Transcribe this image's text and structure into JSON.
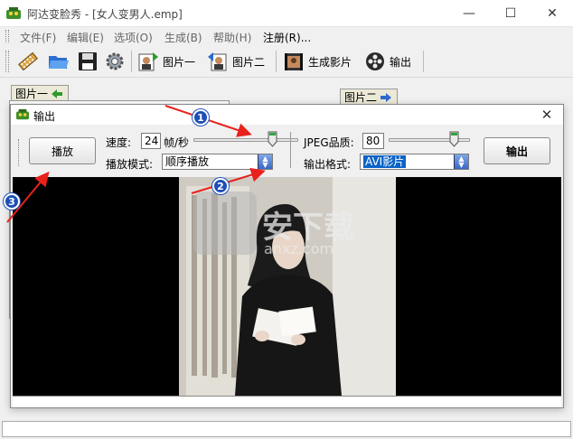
{
  "window": {
    "title": "阿达变脸秀 - [女人变男人.emp]",
    "controls": {
      "minimize": "—",
      "maximize": "☐",
      "close": "✕"
    }
  },
  "menu": {
    "items": [
      "文件(F)",
      "编辑(E)",
      "选项(O)",
      "生成(B)",
      "帮助(H)",
      "注册(R)..."
    ]
  },
  "toolbar": {
    "picture1": "图片一",
    "picture2": "图片二",
    "generate_movie": "生成影片",
    "output": "输出"
  },
  "panels": {
    "left_tab": "图片一",
    "right_tab": "图片二"
  },
  "dialog": {
    "title": "输出",
    "close": "✕",
    "play_button": "播放",
    "speed_label": "速度:",
    "speed_value": "24",
    "speed_unit": "帧/秒",
    "speed_level": 0.75,
    "play_mode_label": "播放模式:",
    "play_mode_value": "顺序播放",
    "jpeg_quality_label": "JPEG品质:",
    "jpeg_quality_value": "80",
    "jpeg_quality_level": 0.8,
    "output_format_label": "输出格式:",
    "output_format_value": "AVI影片",
    "output_button": "输出"
  },
  "watermark": {
    "text": "安下载",
    "url": "anxz.com"
  },
  "annotations": [
    "1",
    "2",
    "3"
  ],
  "colors": {
    "annotation_blue": "#1e4fb8",
    "arrow_red": "#e8211d",
    "selection_blue": "#0a63c8"
  }
}
